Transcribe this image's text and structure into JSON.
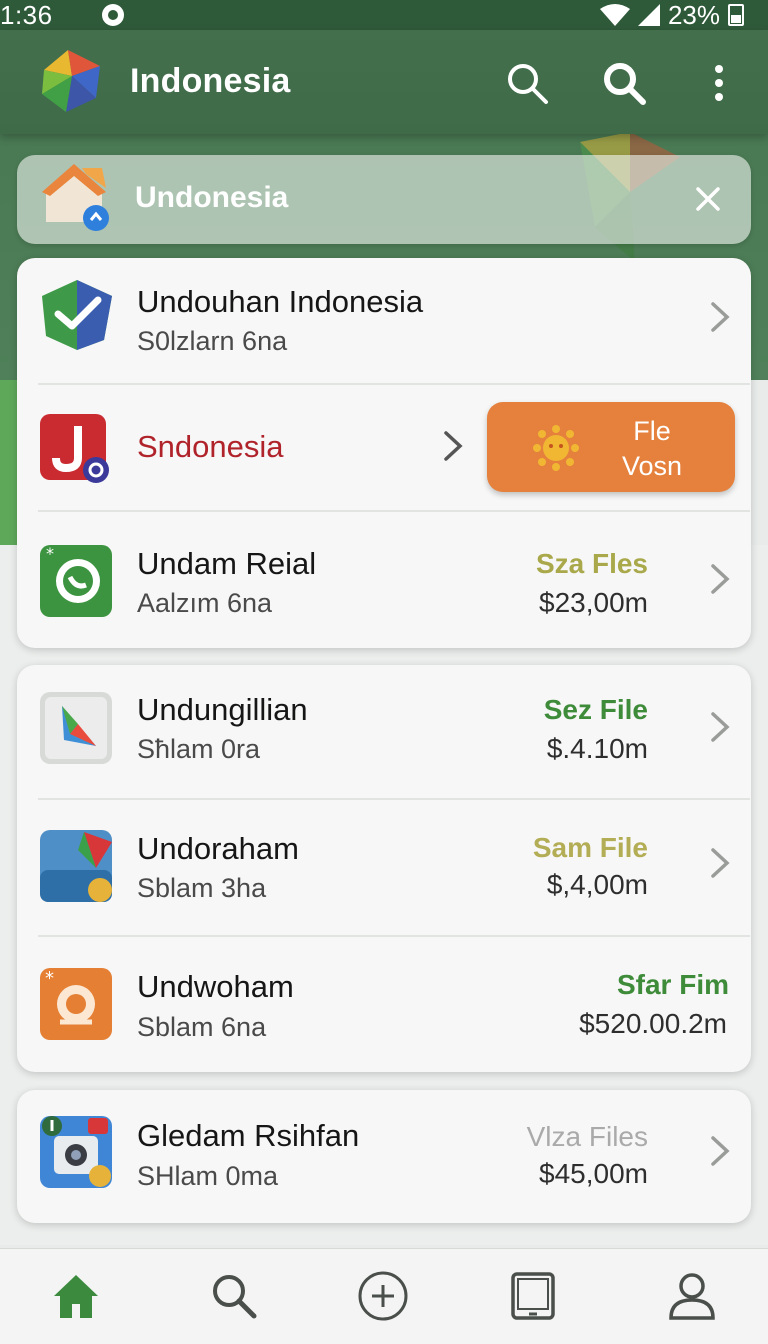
{
  "status_bar": {
    "time": "1:36",
    "battery": "23%"
  },
  "app_bar": {
    "title": "Indonesia"
  },
  "search_chip": {
    "label": "Undonesia"
  },
  "list_top": [
    {
      "title": "Undouhan Indonesia",
      "subtitle": "S0lzlarn 6na"
    },
    {
      "title": "Sndonesia",
      "button_line1": "Fle",
      "button_line2": "Vosn"
    },
    {
      "title": "Undam Reial",
      "subtitle": "Aalzım 6na",
      "size": "Sza Fles",
      "price": "$23,00m",
      "size_color": "#a9a84a"
    }
  ],
  "list_middle": [
    {
      "title": "Undungillian",
      "subtitle": "Sħlam 0ra",
      "size": "Sez File",
      "price": "$.4.10m",
      "size_color": "#3e8b3a"
    },
    {
      "title": "Undoraham",
      "subtitle": "Sblam 3ha",
      "size": "Sam File",
      "price": "$,4,00m",
      "size_color": "#b3ad55"
    },
    {
      "title": "Undwoham",
      "subtitle": "Sblam 6na",
      "size": "Sfar Fim",
      "price": "$520.00.2m",
      "size_color": "#3e8b3a"
    }
  ],
  "list_bottom": [
    {
      "title": "Gledam Rsihfan",
      "subtitle": "SHlam 0ma",
      "size": "Vlza Files",
      "price": "$45,00m",
      "size_color": "#a9aaa9"
    }
  ],
  "colors": {
    "primary_green": "#3f6b49",
    "accent_orange": "#e5813d",
    "nav_active": "#3b8a3e"
  },
  "bottom_nav": [
    "home-icon",
    "search-icon",
    "add-icon",
    "tablet-icon",
    "profile-icon"
  ]
}
